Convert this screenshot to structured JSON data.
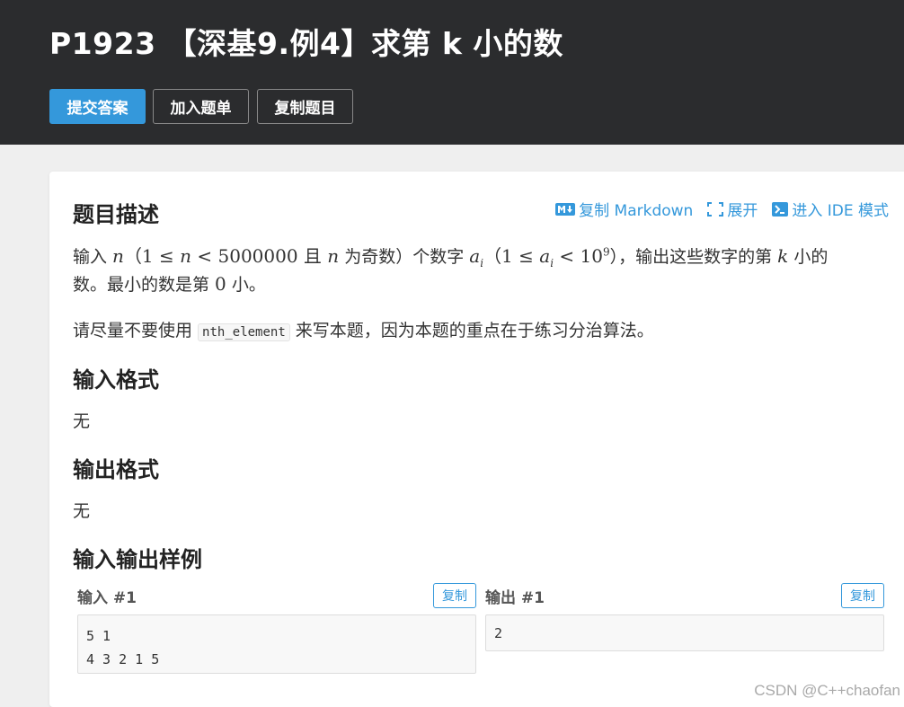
{
  "header": {
    "title": "P1923 【深基9.例4】求第 k 小的数",
    "submit_label": "提交答案",
    "add_list_label": "加入题单",
    "copy_problem_label": "复制题目"
  },
  "toolbar": {
    "copy_markdown": "复制 Markdown",
    "expand": "展开",
    "ide_mode": "进入 IDE 模式"
  },
  "description": {
    "heading": "题目描述",
    "line1": {
      "t1": "输入 ",
      "n": "n",
      "range_a": "（1 ≤ ",
      "range_b": " < 5000000 且 ",
      "t2": " 为奇数）个数字 ",
      "a": "a",
      "i": "i",
      "range2_a": "（1 ≤ ",
      "range2_b": " < 10",
      "exp": "9",
      "range2_c": "），输出这些数字的第 ",
      "k": "k",
      "t3": " 小的"
    },
    "line2_a": "数。最小的数是第 ",
    "line2_zero": "0",
    "line2_b": " 小。",
    "line3_a": "请尽量不要使用 ",
    "line3_code": "nth_element",
    "line3_b": " 来写本题，因为本题的重点在于练习分治算法。"
  },
  "input_format": {
    "heading": "输入格式",
    "text": "无"
  },
  "output_format": {
    "heading": "输出格式",
    "text": "无"
  },
  "samples": {
    "heading": "输入输出样例",
    "input_label": "输入 #1",
    "output_label": "输出 #1",
    "copy_label": "复制",
    "input_value": "5 1\n4 3 2 1 5",
    "output_value": "2"
  },
  "watermark": "CSDN @C++chaofan"
}
